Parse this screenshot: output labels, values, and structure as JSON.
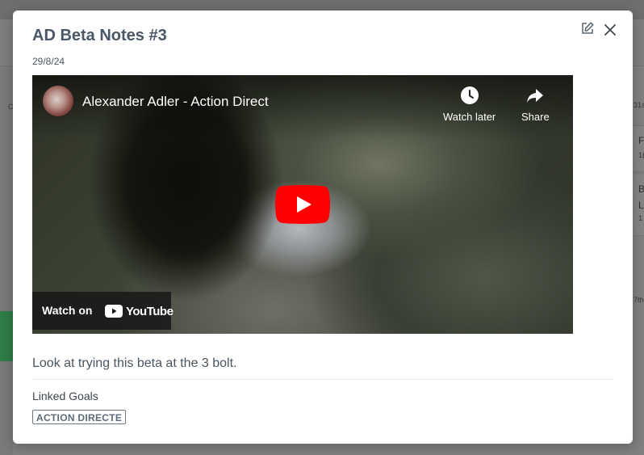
{
  "modal": {
    "title": "AD Beta Notes #3",
    "date": "29/8/24",
    "note": "Look at trying this beta at the 3 bolt.",
    "linked_goals_label": "Linked Goals",
    "linked_goals": [
      "ACTION DIRECTE"
    ],
    "edit_icon": "edit-icon",
    "close_icon": "close-icon"
  },
  "video": {
    "title": "Alexander Adler - Action Direct",
    "watch_later_label": "Watch later",
    "share_label": "Share",
    "watch_on_label": "Watch on",
    "youtube_label": "YouTube",
    "play_icon": "play-icon",
    "clock_icon": "clock-icon",
    "share_icon": "share-arrow-icon",
    "brand_red": "#ff0000"
  },
  "background": {
    "fragments": [
      "F",
      "1(",
      "B",
      "L",
      "1",
      "31s",
      "7th",
      "C"
    ]
  },
  "colors": {
    "backdrop": "#808080",
    "modal_bg": "#ffffff",
    "title": "#4a5768",
    "tag_border": "#6b7785",
    "green_accent": "#2f7d47"
  }
}
